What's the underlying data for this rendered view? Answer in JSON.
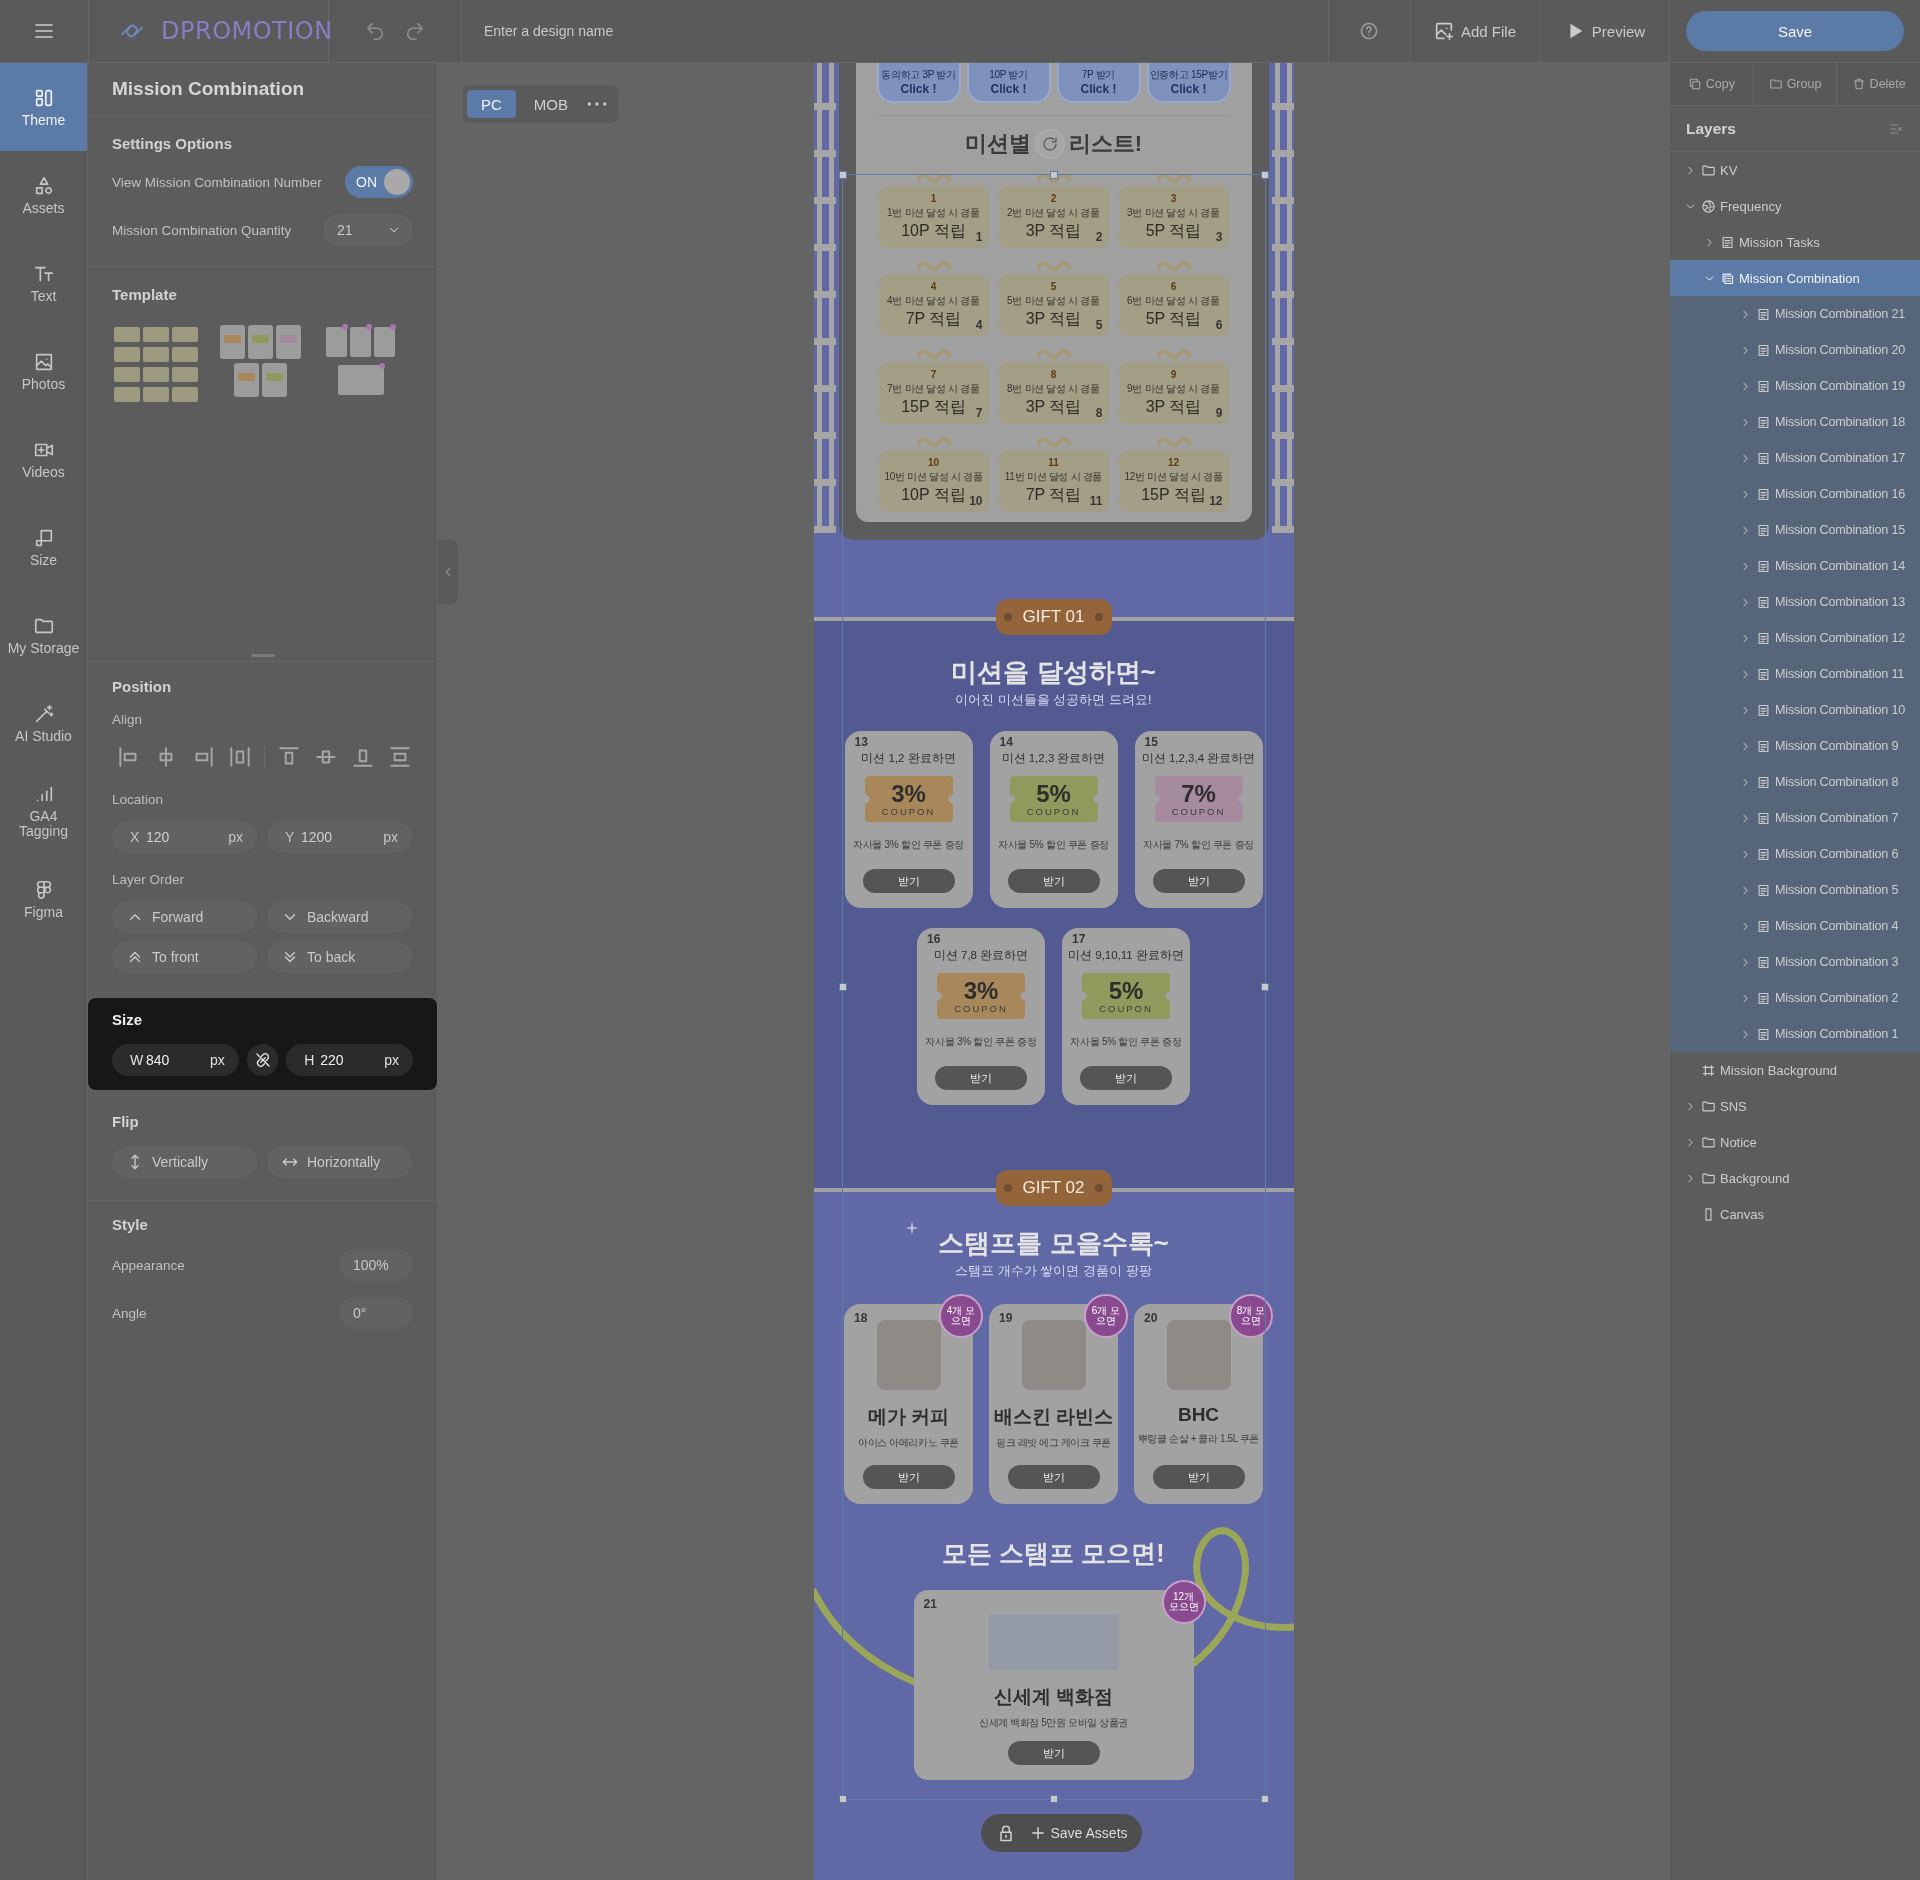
{
  "topbar": {
    "logo": "DPROMOTION",
    "design_name": {
      "placeholder": "Enter a design name"
    },
    "actions": [
      {
        "label": "Add File",
        "kind": "addfile"
      },
      {
        "label": "Preview",
        "kind": "preview"
      }
    ],
    "save": "Save"
  },
  "rail": [
    {
      "label": "Theme",
      "kind": "theme",
      "selected": true
    },
    {
      "label": "Assets",
      "kind": "assets",
      "selected": false
    },
    {
      "label": "Text",
      "kind": "text",
      "selected": false
    },
    {
      "label": "Photos",
      "kind": "photos",
      "selected": false
    },
    {
      "label": "Videos",
      "kind": "videos",
      "selected": false
    },
    {
      "label": "Size",
      "kind": "size",
      "selected": false
    },
    {
      "label": "My Storage",
      "kind": "storage",
      "selected": false
    },
    {
      "label": "AI Studio",
      "kind": "wand",
      "selected": false
    },
    {
      "label": "GA4 Tagging",
      "kind": "chart",
      "selected": false
    },
    {
      "label": "Figma",
      "kind": "figma",
      "selected": false
    }
  ],
  "panel": {
    "title": "Mission Combination",
    "settings": {
      "heading": "Settings Options",
      "toggle": {
        "label": "View Mission Combination Number",
        "text": "ON",
        "on": true
      },
      "quantity": {
        "label": "Mission Combination Quantity",
        "value": "21"
      }
    },
    "template": {
      "heading": "Template"
    },
    "position": {
      "heading": "Position",
      "align_label": "Align",
      "location_label": "Location",
      "x": {
        "axis": "X",
        "value": "120",
        "unit": "px"
      },
      "y": {
        "axis": "Y",
        "value": "1200",
        "unit": "px"
      },
      "order_label": "Layer Order",
      "order_buttons": [
        {
          "label": "Forward",
          "kind": "up"
        },
        {
          "label": "Backward",
          "kind": "down"
        },
        {
          "label": "To front",
          "kind": "dblup"
        },
        {
          "label": "To back",
          "kind": "dbldown"
        }
      ]
    },
    "size": {
      "heading": "Size",
      "w": {
        "axis": "W",
        "value": "840",
        "unit": "px"
      },
      "h": {
        "axis": "H",
        "value": "220",
        "unit": "px"
      },
      "linked": false
    },
    "flip": {
      "heading": "Flip",
      "buttons": [
        {
          "label": "Vertically",
          "kind": "flipv"
        },
        {
          "label": "Horizontally",
          "kind": "fliph"
        }
      ]
    },
    "style": {
      "heading": "Style",
      "rows": [
        {
          "label": "Appearance",
          "value": "100%"
        },
        {
          "label": "Angle",
          "value": "0°"
        }
      ]
    }
  },
  "viewport": {
    "tabs": [
      {
        "label": "PC",
        "selected": true
      },
      {
        "label": "MOB",
        "selected": false
      }
    ]
  },
  "canvas": {
    "mission_buttons": [
      {
        "top": "동의하고 3P 받기",
        "cta": "Click !"
      },
      {
        "top": "10P 받기",
        "cta": "Click !"
      },
      {
        "top": "7P 받기",
        "cta": "Click !"
      },
      {
        "top": "인증하고 15P받기",
        "cta": "Click !"
      }
    ],
    "list_title": {
      "before": "미션별",
      "after": "리스트!"
    },
    "prizes": [
      {
        "badge": "1",
        "caption": "1번 미션 달성 시 경품",
        "reward": "10P 적립",
        "number": "1"
      },
      {
        "badge": "2",
        "caption": "2번 미션 달성 시 경품",
        "reward": "3P 적립",
        "number": "2"
      },
      {
        "badge": "3",
        "caption": "3번 미션 달성 시 경품",
        "reward": "5P 적립",
        "number": "3"
      },
      {
        "badge": "4",
        "caption": "4번 미션 달성 시 경품",
        "reward": "7P 적립",
        "number": "4"
      },
      {
        "badge": "5",
        "caption": "5번 미션 달성 시 경품",
        "reward": "3P 적립",
        "number": "5"
      },
      {
        "badge": "6",
        "caption": "6번 미션 달성 시 경품",
        "reward": "5P 적립",
        "number": "6"
      },
      {
        "badge": "7",
        "caption": "7번 미션 달성 시 경품",
        "reward": "15P 적립",
        "number": "7"
      },
      {
        "badge": "8",
        "caption": "8번 미션 달성 시 경품",
        "reward": "3P 적립",
        "number": "8"
      },
      {
        "badge": "9",
        "caption": "9번 미션 달성 시 경품",
        "reward": "3P 적립",
        "number": "9"
      },
      {
        "badge": "10",
        "caption": "10번 미션 달성 시 경품",
        "reward": "10P 적립",
        "number": "10"
      },
      {
        "badge": "11",
        "caption": "11번 미션 달성 시 경품",
        "reward": "7P 적립",
        "number": "11"
      },
      {
        "badge": "12",
        "caption": "12번 미션 달성 시 경품",
        "reward": "15P 적립",
        "number": "12"
      }
    ],
    "gift01": {
      "tag": "GIFT 01",
      "title": "미션을 달성하면~",
      "subtitle": "이어진 미션들을 성공하면 드려요!",
      "coupons": [
        {
          "condition": "미션 1,2 완료하면",
          "rate": "3%",
          "color": "#a8885a",
          "label": "COUPON",
          "number": "13",
          "desc": "자사몰 3% 할인 쿠폰 증정",
          "button": "받기"
        },
        {
          "condition": "미션 1,2,3 완료하면",
          "rate": "5%",
          "color": "#909a5c",
          "label": "COUPON",
          "number": "14",
          "desc": "자사몰 5% 할인 쿠폰 증정",
          "button": "받기"
        },
        {
          "condition": "미션 1,2,3,4 완료하면",
          "rate": "7%",
          "color": "#a68a9e",
          "label": "COUPON",
          "number": "15",
          "desc": "자사몰 7% 할인 쿠폰 증정",
          "button": "받기"
        },
        {
          "condition": "미션 7,8 완료하면",
          "rate": "3%",
          "color": "#a8885a",
          "label": "COUPON",
          "number": "16",
          "desc": "자사몰 3% 할인 쿠폰 증정",
          "button": "받기"
        },
        {
          "condition": "미션 9,10,11 완료하면",
          "rate": "5%",
          "color": "#909a5c",
          "label": "COUPON",
          "number": "17",
          "desc": "자사몰 5% 할인 쿠폰 증정",
          "button": "받기"
        }
      ]
    },
    "gift02": {
      "tag": "GIFT 02",
      "title": "스탬프를 모을수록~",
      "subtitle": "스탬프 개수가 쌓이면 경품이 팡팡",
      "gifts": [
        {
          "stamp": "4개 모으면",
          "number": "18",
          "name": "메가 커피",
          "desc": "아이스 아메리카노 쿠폰",
          "button": "받기"
        },
        {
          "stamp": "6개 모으면",
          "number": "19",
          "name": "배스킨 라빈스",
          "desc": "핑크 래빗 에그 케이크 쿠폰",
          "button": "받기"
        },
        {
          "stamp": "8개 모으면",
          "number": "20",
          "name": "BHC",
          "desc": "뿌링클 순살 + 콜라 1.5L 쿠폰",
          "button": "받기"
        }
      ],
      "all_title": "모든 스탬프 모으면!",
      "grand": {
        "stamp": "12개 모으면",
        "number": "21",
        "name": "신세계 백화점",
        "desc": "신세계 백화점 5만원 모바일 상품권",
        "button": "받기"
      }
    },
    "asset_bar": {
      "button": "Save Assets"
    }
  },
  "right": {
    "tools": [
      {
        "label": "Copy",
        "kind": "copy",
        "disabled": true
      },
      {
        "label": "Group",
        "kind": "folder",
        "disabled": true
      },
      {
        "label": "Delete",
        "kind": "trash",
        "disabled": true
      }
    ],
    "layers_title": "Layers",
    "layers": [
      {
        "label": "KV",
        "kind": "folder",
        "expanded": false,
        "selected": false
      },
      {
        "label": "Frequency",
        "kind": "aperture",
        "expanded": true,
        "selected": false,
        "children": [
          {
            "label": "Mission Tasks",
            "kind": "list",
            "expanded": false,
            "selected": false
          },
          {
            "label": "Mission Combination",
            "kind": "stack",
            "expanded": true,
            "selected": true,
            "children": [
              {
                "label": "Mission Combination 21",
                "kind": "list",
                "expanded": false,
                "selected": false
              },
              {
                "label": "Mission Combination 20",
                "kind": "list",
                "expanded": false,
                "selected": false
              },
              {
                "label": "Mission Combination 19",
                "kind": "list",
                "expanded": false,
                "selected": false
              },
              {
                "label": "Mission Combination 18",
                "kind": "list",
                "expanded": false,
                "selected": false
              },
              {
                "label": "Mission Combination 17",
                "kind": "list",
                "expanded": false,
                "selected": false
              },
              {
                "label": "Mission Combination 16",
                "kind": "list",
                "expanded": false,
                "selected": false
              },
              {
                "label": "Mission Combination 15",
                "kind": "list",
                "expanded": false,
                "selected": false
              },
              {
                "label": "Mission Combination 14",
                "kind": "list",
                "expanded": false,
                "selected": false
              },
              {
                "label": "Mission Combination 13",
                "kind": "list",
                "expanded": false,
                "selected": false
              },
              {
                "label": "Mission Combination 12",
                "kind": "list",
                "expanded": false,
                "selected": false
              },
              {
                "label": "Mission Combination 11",
                "kind": "list",
                "expanded": false,
                "selected": false
              },
              {
                "label": "Mission Combination 10",
                "kind": "list",
                "expanded": false,
                "selected": false
              },
              {
                "label": "Mission Combination 9",
                "kind": "list",
                "expanded": false,
                "selected": false
              },
              {
                "label": "Mission Combination 8",
                "kind": "list",
                "expanded": false,
                "selected": false
              },
              {
                "label": "Mission Combination 7",
                "kind": "list",
                "expanded": false,
                "selected": false
              },
              {
                "label": "Mission Combination 6",
                "kind": "list",
                "expanded": false,
                "selected": false
              },
              {
                "label": "Mission Combination 5",
                "kind": "list",
                "expanded": false,
                "selected": false
              },
              {
                "label": "Mission Combination 4",
                "kind": "list",
                "expanded": false,
                "selected": false
              },
              {
                "label": "Mission Combination 3",
                "kind": "list",
                "expanded": false,
                "selected": false
              },
              {
                "label": "Mission Combination 2",
                "kind": "list",
                "expanded": false,
                "selected": false
              },
              {
                "label": "Mission Combination 1",
                "kind": "list",
                "expanded": false,
                "selected": false
              }
            ]
          }
        ]
      },
      {
        "label": "Mission Background",
        "kind": "frame",
        "selected": false
      },
      {
        "label": "SNS",
        "kind": "folder",
        "expanded": false,
        "selected": false
      },
      {
        "label": "Notice",
        "kind": "folder",
        "expanded": false,
        "selected": false
      },
      {
        "label": "Background",
        "kind": "folder",
        "expanded": false,
        "selected": false
      },
      {
        "label": "Canvas",
        "kind": "device",
        "selected": false
      }
    ]
  }
}
